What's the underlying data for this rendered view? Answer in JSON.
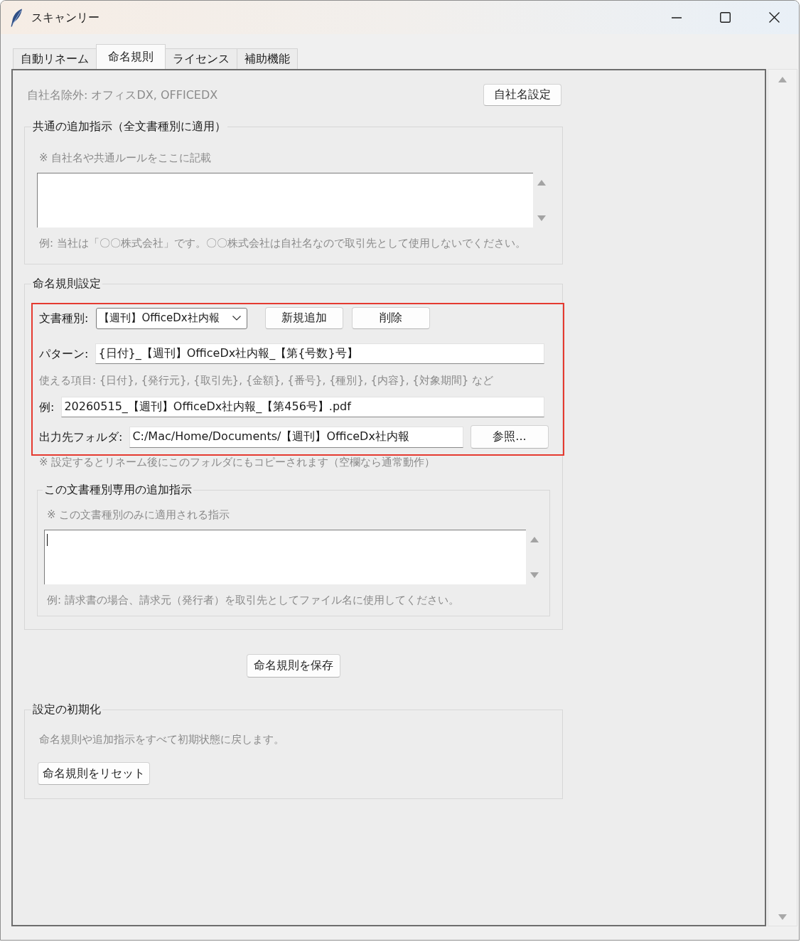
{
  "window": {
    "title": "スキャンリー"
  },
  "tabs": [
    {
      "label": "自動リネーム",
      "selected": false
    },
    {
      "label": "命名規則",
      "selected": true
    },
    {
      "label": "ライセンス",
      "selected": false
    },
    {
      "label": "補助機能",
      "selected": false
    }
  ],
  "company_exclusion": {
    "text": "自社名除外: オフィスDX, OFFICEDX",
    "button": "自社名設定"
  },
  "common_instructions": {
    "title": "共通の追加指示（全文書種別に適用）",
    "hint": "※ 自社名や共通ルールをここに記載",
    "focused": false,
    "example": "例: 当社は「〇〇株式会社」です。〇〇株式会社は自社名なので取引先として使用しないでください。"
  },
  "naming_rules": {
    "title": "命名規則設定",
    "highlighted": true,
    "document_type": {
      "label": "文書種別:",
      "value": "【週刊】OfficeDx社内報"
    },
    "buttons": [
      {
        "kind": "add",
        "label": "新規追加"
      },
      {
        "kind": "delete",
        "label": "削除"
      }
    ],
    "pattern": {
      "label": "パターン:",
      "value": "{日付}_【週刊】OfficeDx社内報_【第{号数}号】"
    },
    "available_items": "使える項目: {日付}, {発行元}, {取引先}, {金額}, {番号}, {種別}, {内容}, {対象期間} など",
    "example": {
      "label": "例:",
      "value": "20260515_【週刊】OfficeDx社内報_【第456号】.pdf"
    },
    "output_folder": {
      "label": "出力先フォルダ:",
      "value": "C:/Mac/Home/Documents/【週刊】OfficeDx社内報",
      "button": "参照..."
    },
    "output_note": "※ 設定するとリネーム後にこのフォルダにもコピーされます（空欄なら通常動作）",
    "type_instructions": {
      "title": "この文書種別専用の追加指示",
      "hint": "※ この文書種別のみに適用される指示",
      "focused": true,
      "example": "例: 請求書の場合、請求元（発行者）を取引先としてファイル名に使用してください。"
    }
  },
  "save_button": "命名規則を保存",
  "reset": {
    "title": "設定の初期化",
    "description": "命名規則や追加指示をすべて初期状態に戻します。",
    "button": "命名規則をリセット"
  }
}
